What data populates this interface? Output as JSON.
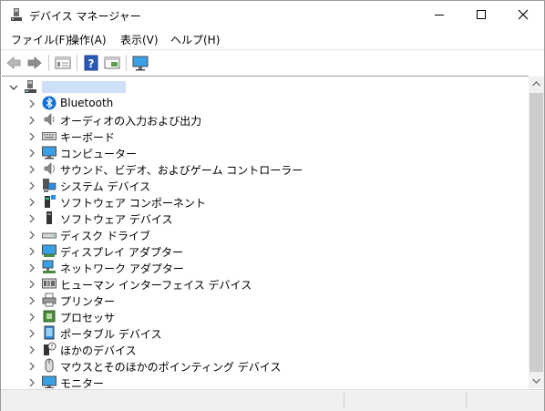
{
  "window": {
    "title": "デバイス マネージャー",
    "controls": {
      "minimize": "minimize",
      "maximize": "maximize",
      "close": "close"
    }
  },
  "menu": [
    {
      "label": "ファイル(F)"
    },
    {
      "label": "操作(A)"
    },
    {
      "label": "表示(V)"
    },
    {
      "label": "ヘルプ(H)"
    }
  ],
  "toolbar": {
    "buttons": [
      "back-arrow-icon",
      "forward-arrow-icon",
      "properties-icon",
      "help-icon",
      "view-icon",
      "monitor-icon"
    ]
  },
  "tree": {
    "root": {
      "icon": "computer-root-icon",
      "expanded": true
    },
    "items": [
      {
        "label": "Bluetooth",
        "icon": "bluetooth-icon"
      },
      {
        "label": "オーディオの入力および出力",
        "icon": "speaker-icon"
      },
      {
        "label": "キーボード",
        "icon": "keyboard-icon"
      },
      {
        "label": "コンピューター",
        "icon": "computer-icon"
      },
      {
        "label": "サウンド、ビデオ、およびゲーム コントローラー",
        "icon": "sound-icon"
      },
      {
        "label": "システム デバイス",
        "icon": "system-device-icon"
      },
      {
        "label": "ソフトウェア コンポーネント",
        "icon": "software-component-icon"
      },
      {
        "label": "ソフトウェア デバイス",
        "icon": "software-device-icon"
      },
      {
        "label": "ディスク ドライブ",
        "icon": "disk-drive-icon"
      },
      {
        "label": "ディスプレイ アダプター",
        "icon": "display-adapter-icon"
      },
      {
        "label": "ネットワーク アダプター",
        "icon": "network-adapter-icon"
      },
      {
        "label": "ヒューマン インターフェイス デバイス",
        "icon": "hid-icon"
      },
      {
        "label": "プリンター",
        "icon": "printer-icon"
      },
      {
        "label": "プロセッサ",
        "icon": "processor-icon"
      },
      {
        "label": "ポータブル デバイス",
        "icon": "portable-device-icon"
      },
      {
        "label": "ほかのデバイス",
        "icon": "other-device-icon"
      },
      {
        "label": "マウスとそのほかのポインティング デバイス",
        "icon": "mouse-icon"
      },
      {
        "label": "モニター",
        "icon": "monitor-icon"
      }
    ]
  },
  "colors": {
    "selection": "#cde0f7",
    "bluetooth": "#0a6fd6",
    "scroll_track": "#f0f0f0",
    "scroll_thumb": "#cdcdcd"
  }
}
